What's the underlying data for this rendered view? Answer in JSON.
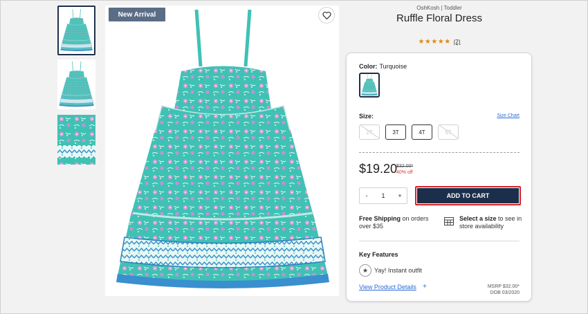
{
  "product": {
    "brand": "OshKosh | Toddler",
    "title": "Ruffle Floral Dress",
    "badge": "New Arrival",
    "stars": "★★★★★",
    "review_count": "(2)"
  },
  "color": {
    "label": "Color:",
    "value": "Turquoise"
  },
  "size": {
    "label": "Size:",
    "chart_link": "Size Chart",
    "options": [
      {
        "label": "2T",
        "available": false
      },
      {
        "label": "3T",
        "available": true
      },
      {
        "label": "4T",
        "available": true
      },
      {
        "label": "5T",
        "available": false
      }
    ]
  },
  "price": {
    "current": "$19.20",
    "original": "$32.00*",
    "discount": "40% off"
  },
  "quantity": {
    "minus": "-",
    "value": "1",
    "plus": "+"
  },
  "cart": {
    "add_label": "ADD TO CART"
  },
  "shipping": {
    "bold": "Free Shipping",
    "rest": " on orders over $35"
  },
  "store": {
    "bold": "Select a size",
    "rest": " to see in store availability"
  },
  "features": {
    "title": "Key Features",
    "items": [
      "Yay! Instant outfit"
    ]
  },
  "details": {
    "link": "View Product Details",
    "plus": "+"
  },
  "meta": {
    "msrp": "MSRP $32.00*",
    "dob": "DOB 03/2020"
  },
  "colors": {
    "navy": "#1c2f4a",
    "dress_teal": "#3fc2b4",
    "badge": "#5b6d86",
    "star": "#e08a16",
    "link": "#2a6ad4",
    "highlight": "#d91f26",
    "sale": "#d23b3b"
  },
  "icons": {
    "favorite": "heart-icon",
    "store": "store-grid-icon",
    "feature": "star-badge-icon"
  }
}
